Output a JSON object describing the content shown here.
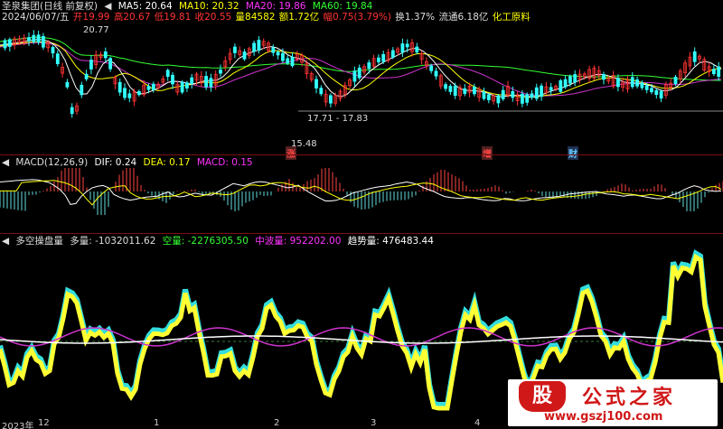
{
  "header": {
    "title": "圣泉集团(日线 前复权)",
    "ma5": "MA5: 20.64",
    "ma10": "MA10: 20.32",
    "ma20": "MA20: 19.86",
    "ma60": "MA60: 19.84",
    "ma5_color": "#ffffff",
    "ma10_color": "#ffff00",
    "ma20_color": "#ff33ff",
    "ma60_color": "#33ff33"
  },
  "quote": {
    "date": "2024/06/07/五",
    "open": "开19.99",
    "high": "高20.67",
    "low": "低19.81",
    "close": "收20.55",
    "volume": "量84582",
    "amount": "额1.72亿",
    "change": "幅0.75(3.79%)",
    "turnover": "换1.37%",
    "float": "流通6.18亿",
    "sector": "化工原料"
  },
  "price_chart": {
    "high_label": "20.77",
    "range_label": "17.71 - 17.83",
    "low_label": "15.48",
    "tags": [
      "涨",
      "增",
      "财"
    ]
  },
  "macd": {
    "title": "MACD(12,26,9)",
    "dif": "DIF: 0.24",
    "dea": "DEA: 0.17",
    "macd": "MACD: 0.15"
  },
  "indicator": {
    "title": "多空操盘量",
    "long_vol": "多量: -1032011.62",
    "short_vol": "空量: -2276305.50",
    "neutral_vol": "中波量: 952202.00",
    "trend_vol": "趋势量: 476483.44"
  },
  "axis": {
    "labels": [
      "2023年",
      "12",
      "1",
      "2",
      "3",
      "4"
    ]
  },
  "watermark": {
    "logo_char": "股",
    "name": "公式之家",
    "url": "www.gszj100.com"
  }
}
